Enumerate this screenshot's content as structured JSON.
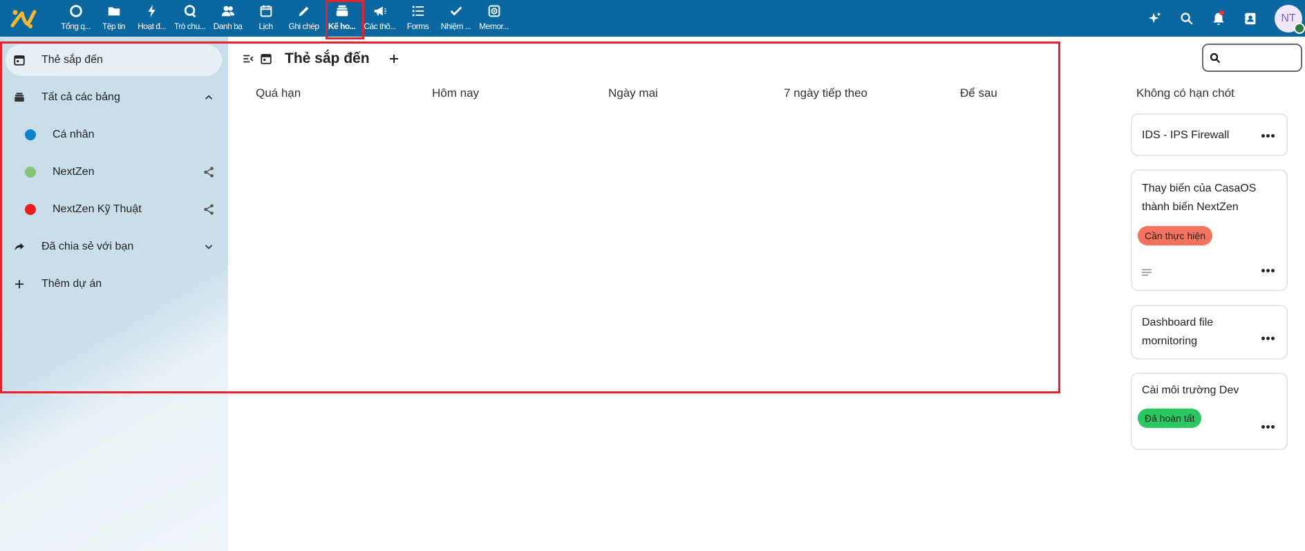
{
  "header": {
    "apps": [
      {
        "label": "Tổng q...",
        "icon": "circle-icon"
      },
      {
        "label": "Tệp tin",
        "icon": "folder-icon"
      },
      {
        "label": "Hoạt đ...",
        "icon": "lightning-icon"
      },
      {
        "label": "Trò chu...",
        "icon": "chat-icon"
      },
      {
        "label": "Danh bạ",
        "icon": "contacts-icon"
      },
      {
        "label": "Lịch",
        "icon": "calendar-icon"
      },
      {
        "label": "Ghi chép",
        "icon": "pencil-icon"
      },
      {
        "label": "Kế ho...",
        "icon": "deck-icon"
      },
      {
        "label": "Các thô...",
        "icon": "megaphone-icon"
      },
      {
        "label": "Forms",
        "icon": "list-icon"
      },
      {
        "label": "Nhiệm ...",
        "icon": "check-icon"
      },
      {
        "label": "Memor...",
        "icon": "photo-icon"
      }
    ],
    "active_app": "Kế ho...",
    "avatar_initials": "NT",
    "accent_color": "#0a679f"
  },
  "sidebar": {
    "upcoming": "Thẻ sắp đến",
    "all_boards": "Tất cả các bảng",
    "boards": [
      {
        "label": "Cá nhân",
        "color": "#0d84c8",
        "shared": false
      },
      {
        "label": "NextZen",
        "color": "#86c577",
        "shared": true
      },
      {
        "label": "NextZen Kỹ Thuật",
        "color": "#e61e1e",
        "shared": true
      }
    ],
    "shared_with_you": "Đã chia sẻ với bạn",
    "add_project": "Thêm dự án"
  },
  "main": {
    "title": "Thẻ sắp đến",
    "columns": [
      "Quá hạn",
      "Hôm nay",
      "Ngày mai",
      "7 ngày tiếp theo",
      "Để sau"
    ],
    "no_deadline_header": "Không có hạn chót",
    "search_placeholder": ""
  },
  "cards": [
    {
      "title_lines": [
        "IDS - IPS Firewall"
      ],
      "tag": null
    },
    {
      "title_lines": [
        "Thay biến của CasaOS",
        "thành biến NextZen"
      ],
      "tag": {
        "label": "Cần thực hiện",
        "color": "#f3735f"
      },
      "has_description": true
    },
    {
      "title_lines": [
        "Dashboard file",
        "mornitoring"
      ],
      "tag": null
    },
    {
      "title_lines": [
        "Cài môi trường Dev"
      ],
      "tag": {
        "label": "Đã hoàn tất",
        "color": "#2bc760"
      }
    }
  ]
}
